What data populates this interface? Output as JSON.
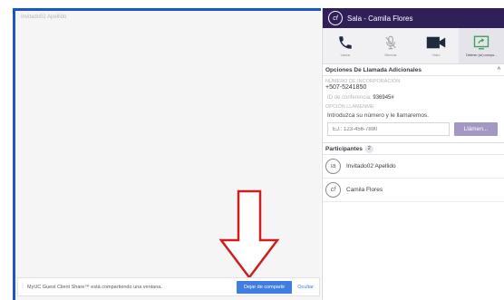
{
  "screen": {
    "owner_label": "Invitado02 Apellido"
  },
  "share_bar": {
    "message": "MyUC Guest Client Share™ está compartiendo una ventana.",
    "stop_label": "Dejar de compartir",
    "hide_label": "Ocultar"
  },
  "room": {
    "avatar_initials": "cf",
    "title": "Sala - Camila Flores"
  },
  "controls": [
    {
      "label": "Llamar",
      "icon": "phone-icon"
    },
    {
      "label": "Silenciar",
      "icon": "mic-muted-icon"
    },
    {
      "label": "Video",
      "icon": "video-camera-icon"
    },
    {
      "label": "Detener (se) compa...",
      "icon": "screen-share-icon"
    }
  ],
  "options": {
    "title": "Opciones De Llamada Adicionales",
    "dial_in_label": "NÚMERO DE INCORPORACIÓN",
    "dial_in_number": "+507-5241850",
    "conference_label": "ID de conferencia:",
    "conference_id": "936945#",
    "callme_label": "OPCIÓN LLÁMENME",
    "callme_hint": "Introduzca su número y le llamaremos.",
    "phone_placeholder": "EJ.: 123-456-7890",
    "call_me_button": "Llámen..."
  },
  "participants": {
    "title": "Participantes",
    "count": "2",
    "items": [
      {
        "initials": "ia",
        "name": "Invitado02 Apellido"
      },
      {
        "initials": "cf",
        "name": "Camila Flores"
      }
    ]
  },
  "colors": {
    "header_bg": "#311f59",
    "accent_blue": "#3f7de0",
    "screen_border": "#1a56c4",
    "arrow_red": "#cc1f1f",
    "call_button": "#a497c4",
    "share_icon_green": "#3aa05a"
  }
}
